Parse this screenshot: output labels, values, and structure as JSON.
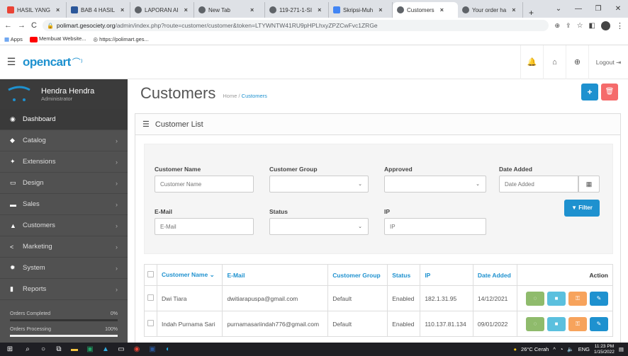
{
  "browser": {
    "tabs": [
      {
        "label": "HASIL YANG",
        "color": "#ea4335"
      },
      {
        "label": "BAB 4 HASIL",
        "color": "#2b579a"
      },
      {
        "label": "LAPORAN AI",
        "color": "#5f6368"
      },
      {
        "label": "New Tab",
        "color": "#5f6368"
      },
      {
        "label": "119-271-1-SI",
        "color": "#5f6368"
      },
      {
        "label": "Skripsi-Muh",
        "color": "#4285f4"
      },
      {
        "label": "Customers",
        "color": "#5f6368"
      },
      {
        "label": "Your order ha",
        "color": "#5f6368"
      }
    ],
    "url_domain": "polimart.gesociety.org",
    "url_path": "/admin/index.php?route=customer/customer&token=LTYWNTW41RU9pHPLhxyZPZCwFvc1ZRGe",
    "bookmarks": [
      "Apps",
      "Membuat Website...",
      "https://polimart.ges..."
    ]
  },
  "header": {
    "logo": "opencart",
    "logout": "Logout"
  },
  "sidebar": {
    "user_name": "Hendra Hendra",
    "user_role": "Administrator",
    "items": [
      {
        "label": "Dashboard",
        "icon": "dashboard-icon",
        "glyph": "◉"
      },
      {
        "label": "Catalog",
        "icon": "tag-icon",
        "glyph": "◆"
      },
      {
        "label": "Extensions",
        "icon": "puzzle-icon",
        "glyph": "✦"
      },
      {
        "label": "Design",
        "icon": "monitor-icon",
        "glyph": "▭"
      },
      {
        "label": "Sales",
        "icon": "cart-icon",
        "glyph": "▬"
      },
      {
        "label": "Customers",
        "icon": "user-icon",
        "glyph": "▲"
      },
      {
        "label": "Marketing",
        "icon": "share-icon",
        "glyph": "<"
      },
      {
        "label": "System",
        "icon": "gear-icon",
        "glyph": "✹"
      },
      {
        "label": "Reports",
        "icon": "bar-chart-icon",
        "glyph": "▮"
      }
    ],
    "stats": [
      {
        "label": "Orders Completed",
        "pct": "0%",
        "value": 0
      },
      {
        "label": "Orders Processing",
        "pct": "100%",
        "value": 1
      }
    ]
  },
  "page": {
    "title": "Customers",
    "breadcrumb_home": "Home",
    "breadcrumb_sep": "/",
    "breadcrumb_current": "Customers",
    "panel_title": "Customer List"
  },
  "filter": {
    "customer_name_label": "Customer Name",
    "customer_name_placeholder": "Customer Name",
    "customer_group_label": "Customer Group",
    "approved_label": "Approved",
    "date_added_label": "Date Added",
    "date_added_placeholder": "Date Added",
    "email_label": "E-Mail",
    "email_placeholder": "E-Mail",
    "status_label": "Status",
    "ip_label": "IP",
    "ip_placeholder": "IP",
    "filter_button": "Filter"
  },
  "table": {
    "columns": [
      "Customer Name",
      "E-Mail",
      "Customer Group",
      "Status",
      "IP",
      "Date Added",
      "Action"
    ],
    "rows": [
      {
        "name": "Dwi Tiara",
        "email": "dwitiarapuspa@gmail.com",
        "group": "Default",
        "status": "Enabled",
        "ip": "182.1.31.95",
        "date": "14/12/2021"
      },
      {
        "name": "Indah Purnama Sari",
        "email": "purnamasariindah776@gmail.com",
        "group": "Default",
        "status": "Enabled",
        "ip": "110.137.81.134",
        "date": "09/01/2022"
      }
    ]
  },
  "taskbar": {
    "weather": "26°C Cerah",
    "lang": "ENG",
    "time": "11:23 PM",
    "date": "1/15/2022"
  }
}
